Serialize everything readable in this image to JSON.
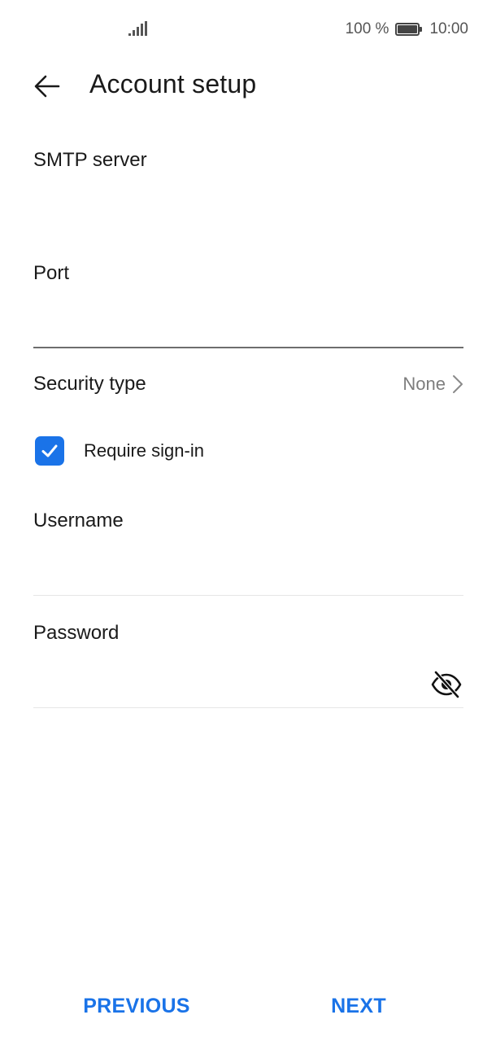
{
  "status_bar": {
    "battery_text": "100 %",
    "time": "10:00",
    "icons": [
      "signal-icon",
      "battery-icon"
    ]
  },
  "header": {
    "title": "Account setup",
    "back_icon": "back-arrow-icon"
  },
  "form": {
    "smtp_server": {
      "label": "SMTP server",
      "value": ""
    },
    "port": {
      "label": "Port",
      "value": ""
    },
    "security_type": {
      "label": "Security type",
      "value": "None",
      "icon": "chevron-right-icon"
    },
    "require_signin": {
      "label": "Require sign-in",
      "checked": true
    },
    "username": {
      "label": "Username",
      "value": ""
    },
    "password": {
      "label": "Password",
      "value": "",
      "toggle_icon": "eye-off-icon"
    }
  },
  "footer": {
    "previous_label": "PREVIOUS",
    "next_label": "NEXT"
  },
  "colors": {
    "accent": "#1a73e8",
    "text": "#1a1a1a",
    "secondary_text": "#7d7d7d",
    "divider": "#e6e6e6"
  }
}
